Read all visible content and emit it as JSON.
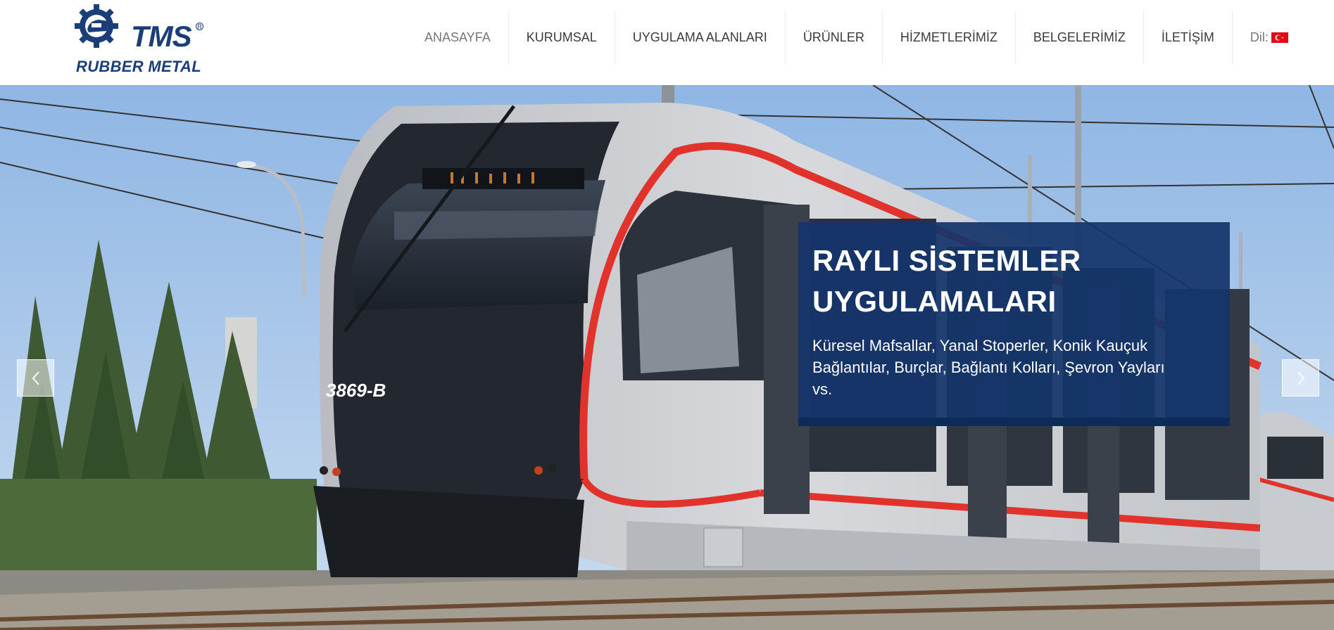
{
  "brand": {
    "tms": "TMS",
    "reg": "R",
    "tagline": "RUBBER METAL",
    "color": "#1b3e78"
  },
  "nav": {
    "items": [
      {
        "label": "ANASAYFA"
      },
      {
        "label": "KURUMSAL"
      },
      {
        "label": "UYGULAMA ALANLARI"
      },
      {
        "label": "ÜRÜNLER"
      },
      {
        "label": "HİZMETLERİMİZ"
      },
      {
        "label": "BELGELERİMİZ"
      },
      {
        "label": "İLETİŞİM"
      }
    ],
    "active": "ANASAYFA",
    "language_label": "Dil:",
    "language_icon": "turkey-flag-icon"
  },
  "hero": {
    "tram_number": "3869-B",
    "title_line1": "RAYLI SİSTEMLER",
    "title_line2": "UYGULAMALARI",
    "text": "Küresel Mafsallar, Yanal Stoperler, Konik Kauçuk Bağlantılar, Burçlar, Bağlantı Kolları, Şevron Yayları vs.",
    "prev_icon": "chevron-left-icon",
    "next_icon": "chevron-right-icon",
    "caption_bg": "#14356b"
  }
}
